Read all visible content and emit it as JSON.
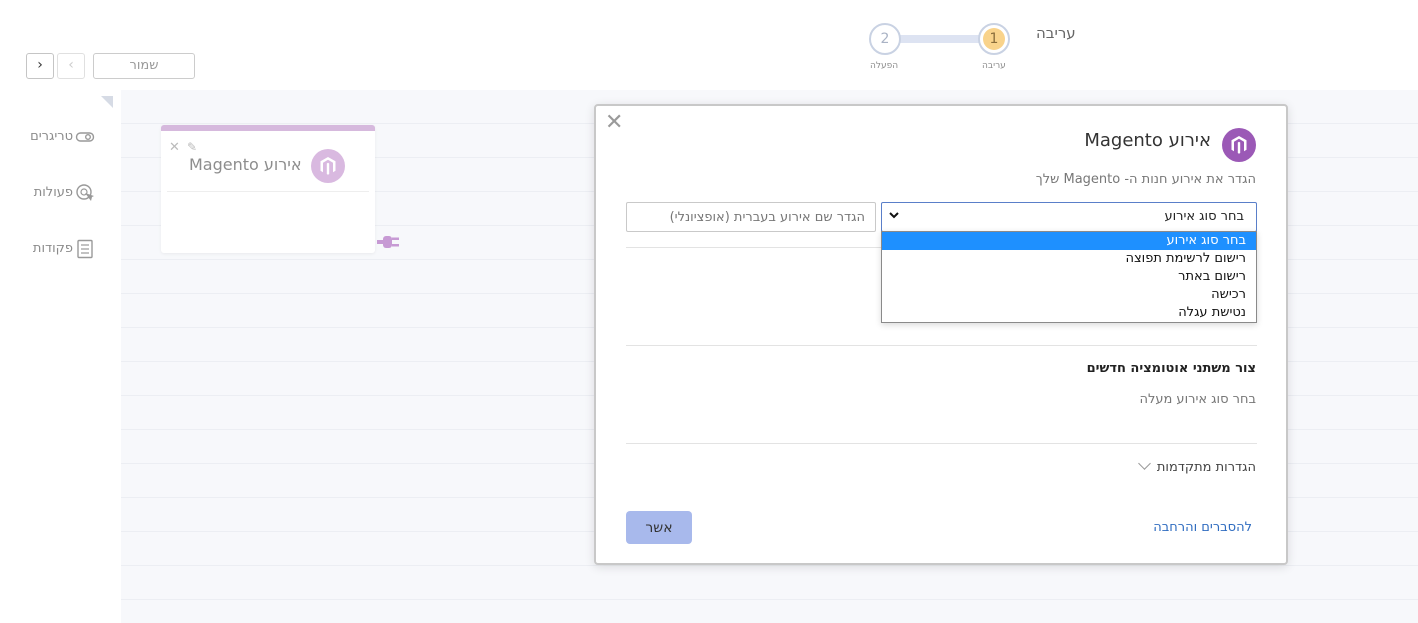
{
  "header": {
    "page_title": "עריבה",
    "steps": [
      {
        "number": "1",
        "label": "עריבה",
        "active": true
      },
      {
        "number": "2",
        "label": "הפעלה",
        "active": false
      }
    ],
    "save_label": "שמור",
    "next_glyph": "›",
    "prev_glyph": "‹"
  },
  "sidebar": {
    "items": [
      {
        "label": "טריגרים",
        "icon": "toggle-icon"
      },
      {
        "label": "פעולות",
        "icon": "cursor-click-icon"
      },
      {
        "label": "פקודות",
        "icon": "document-list-icon"
      }
    ]
  },
  "node": {
    "title": "אירוע Magento",
    "icon": "magento-icon",
    "close_glyph": "✕",
    "edit_glyph": "✎"
  },
  "modal": {
    "close_glyph": "✕",
    "title": "אירוע Magento",
    "subtitle": "הגדר את אירוע חנות ה- Magento שלך",
    "name_placeholder": "הגדר שם אירוע בעברית (אופציונלי)",
    "select_value": "בחר סוג אירוע",
    "options": [
      "בחר סוג אירוע",
      "רישום לרשימת תפוצה",
      "רישום באתר",
      "רכישה",
      "נטישת עגלה"
    ],
    "selected_option_index": 0,
    "variables_title": "צור משתני אוטומציה חדשים",
    "variables_note": "בחר סוג אירוע מעלה",
    "advanced_label": "הגדרות מתקדמות",
    "confirm_label": "אשר",
    "help_link": "להסברים והרחבה"
  },
  "colors": {
    "accent_purple": "#9b59b6",
    "node_purple": "#d9b9e0",
    "step_active": "#f9d38b",
    "confirm_button": "#a8b9ec",
    "link_blue": "#2f6cc0",
    "option_highlight": "#1e90ff"
  }
}
